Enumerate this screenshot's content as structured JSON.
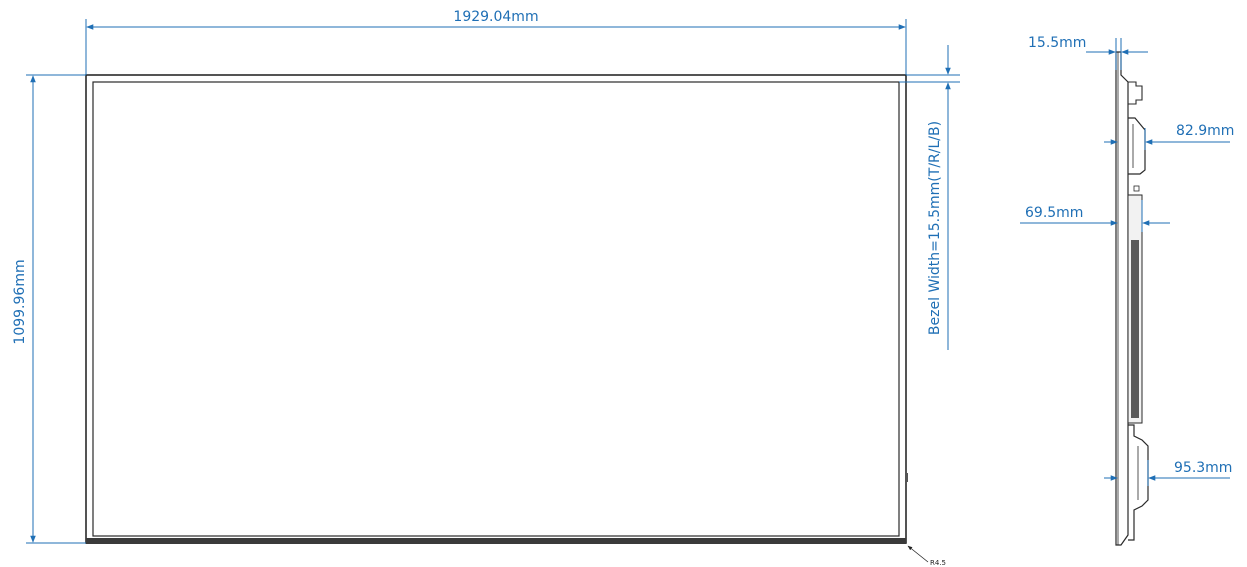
{
  "colors": {
    "dimension": "#1f6fb5",
    "outline": "#2a2a2a",
    "background": "#ffffff"
  },
  "front_view": {
    "width_label": "1929.04mm",
    "height_label": "1099.96mm",
    "bezel_label": "Bezel Width=15.5mm(T/R/L/B)",
    "corner_radius_label": "R4.5"
  },
  "side_view": {
    "depth_top_label": "15.5mm",
    "depth_upper_bracket_label": "82.9mm",
    "depth_middle_label": "69.5mm",
    "depth_lower_bracket_label": "95.3mm"
  }
}
